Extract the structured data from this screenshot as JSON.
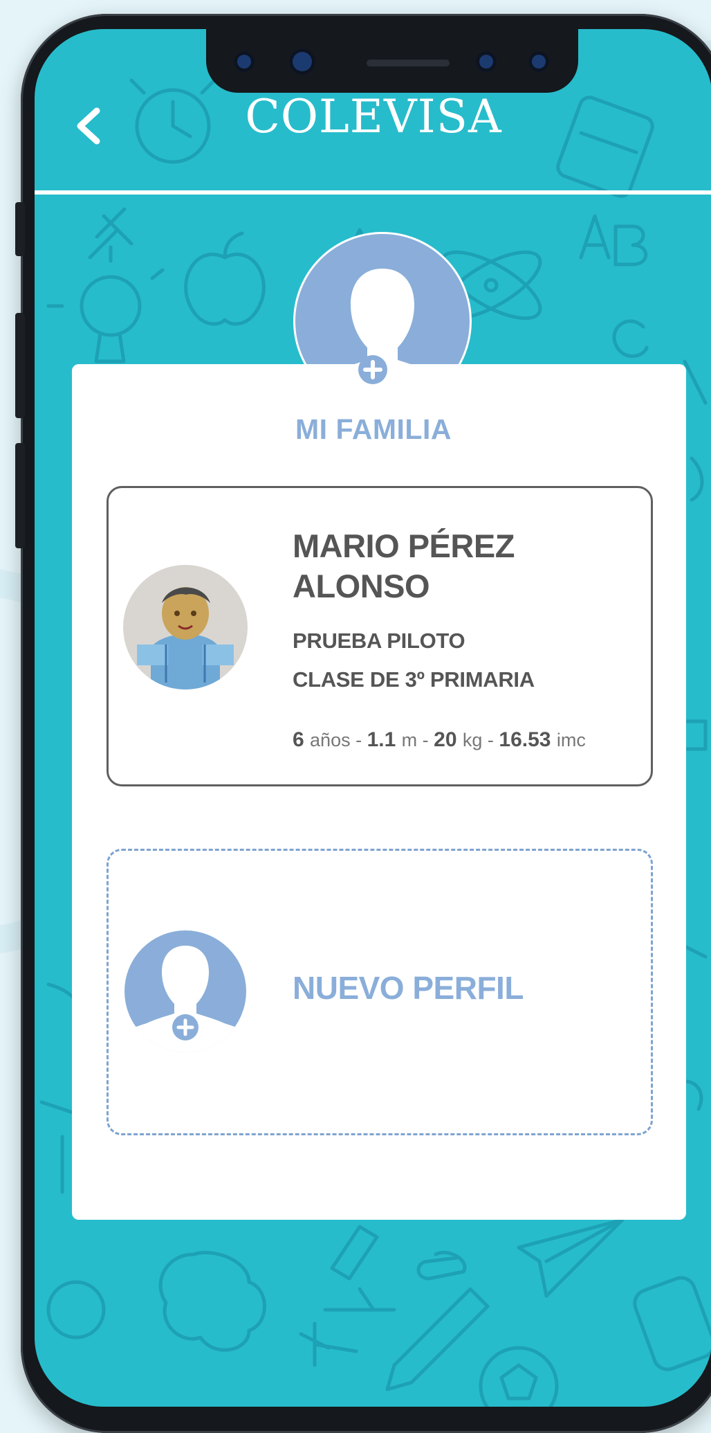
{
  "app": {
    "logo_text": "COLEVISA"
  },
  "header": {
    "back_icon": "chevron-left-icon"
  },
  "profile": {
    "avatar_icon": "user-silhouette-icon",
    "add_icon": "plus-circle-icon"
  },
  "family": {
    "title": "MI FAMILIA",
    "members": [
      {
        "name": "MARIO PÉREZ ALONSO",
        "school": "PRUEBA PILOTO",
        "class": "CLASE DE 3º PRIMARIA",
        "age": "6",
        "age_unit": "años",
        "height": "1.1",
        "height_unit": "m",
        "weight": "20",
        "weight_unit": "kg",
        "bmi": "16.53",
        "bmi_unit": "imc",
        "separator": " - "
      }
    ],
    "new_profile": {
      "label": "NUEVO PERFIL",
      "icon": "user-plus-icon"
    }
  },
  "colors": {
    "background": "#27bccb",
    "card": "#ffffff",
    "accent": "#8aaed9",
    "text": "#555555"
  }
}
